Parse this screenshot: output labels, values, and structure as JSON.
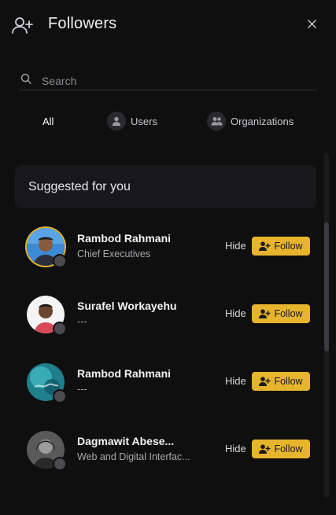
{
  "header": {
    "title": "Followers",
    "icon": "add-user-icon",
    "close_icon": "close-icon"
  },
  "search": {
    "placeholder": "Search",
    "value": ""
  },
  "tabs": [
    {
      "label": "All",
      "active": true
    },
    {
      "label": "Users",
      "icon": "user-icon"
    },
    {
      "label": "Organizations",
      "icon": "users-group-icon"
    }
  ],
  "suggested": {
    "title": "Suggested for you"
  },
  "people": [
    {
      "name": "Rambod Rahmani",
      "subtitle": "Chief Executives",
      "hide_label": "Hide",
      "follow_label": "Follow"
    },
    {
      "name": "Surafel Workayehu",
      "subtitle": "---",
      "hide_label": "Hide",
      "follow_label": "Follow"
    },
    {
      "name": "Rambod Rahmani",
      "subtitle": "---",
      "hide_label": "Hide",
      "follow_label": "Follow"
    },
    {
      "name": "Dagmawit Abese...",
      "subtitle": "Web and Digital Interfac...",
      "hide_label": "Hide",
      "follow_label": "Follow"
    }
  ],
  "colors": {
    "accent": "#e6b52d",
    "background": "#0f0f10",
    "status_dot": "#4a4a4f"
  }
}
